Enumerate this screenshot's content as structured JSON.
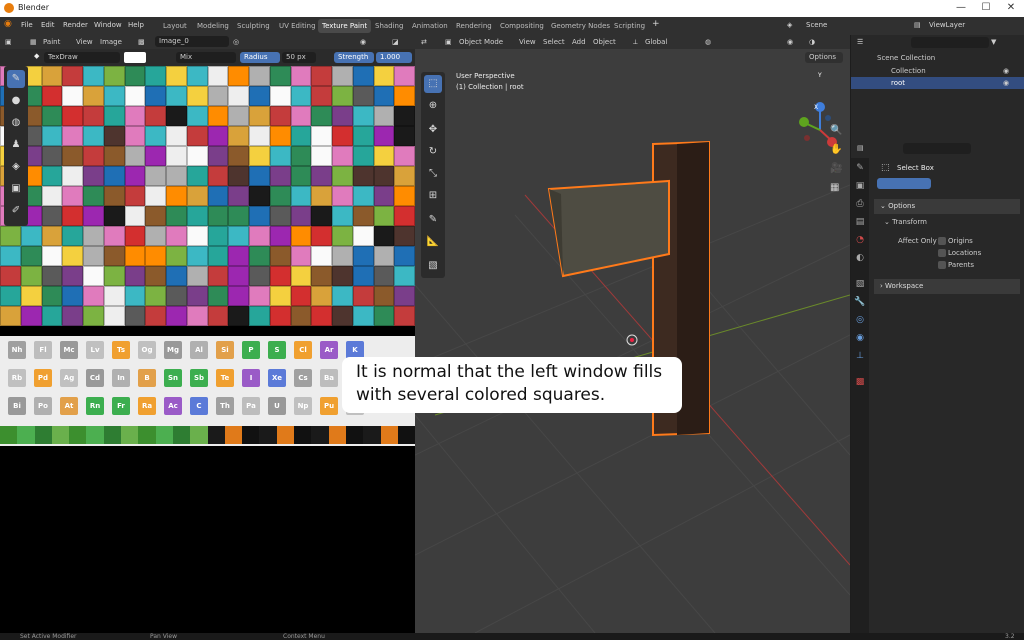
{
  "window": {
    "title": "Blender",
    "controls": [
      "—",
      "☐",
      "✕"
    ]
  },
  "menu": [
    "File",
    "Edit",
    "Render",
    "Window",
    "Help"
  ],
  "workspaces": [
    {
      "label": "Layout",
      "active": false
    },
    {
      "label": "Modeling",
      "active": false
    },
    {
      "label": "Sculpting",
      "active": false
    },
    {
      "label": "UV Editing",
      "active": false
    },
    {
      "label": "Texture Paint",
      "active": true
    },
    {
      "label": "Shading",
      "active": false
    },
    {
      "label": "Animation",
      "active": false
    },
    {
      "label": "Rendering",
      "active": false
    },
    {
      "label": "Compositing",
      "active": false
    },
    {
      "label": "Geometry Nodes",
      "active": false
    },
    {
      "label": "Scripting",
      "active": false
    }
  ],
  "scene": {
    "label": "Scene",
    "view_layer": "ViewLayer"
  },
  "image_editor": {
    "mode": "Paint",
    "menus": [
      "View",
      "Image"
    ],
    "image_name": "Image_0",
    "tool_name": "TexDraw",
    "blend": "Mix",
    "radius_label": "Radius",
    "radius_value": "50 px",
    "strength_label": "Strength",
    "strength_value": "1.000"
  },
  "elements_rows": [
    [
      "Nh",
      "Fl",
      "Mc",
      "Lv",
      "Ts",
      "Og",
      "Mg",
      "Al",
      "Si",
      "P",
      "S",
      "Cl",
      "Ar",
      "K"
    ],
    [
      "Rb",
      "Pd",
      "Ag",
      "Cd",
      "In",
      "B",
      "Sn",
      "Sb",
      "Te",
      "I",
      "Xe",
      "Cs",
      "Ba",
      "La"
    ],
    [
      "Bi",
      "Po",
      "At",
      "Rn",
      "Fr",
      "Ra",
      "Ac",
      "C",
      "Th",
      "Pa",
      "U",
      "Np",
      "Pu",
      "Am"
    ]
  ],
  "viewport": {
    "mode": "Object Mode",
    "menus": [
      "View",
      "Select",
      "Add",
      "Object"
    ],
    "orientation": "Global",
    "options": "Options",
    "perspective": "User Perspective",
    "collection_info": "(1) Collection | root",
    "gizmo_axes": {
      "x": "X",
      "y": "Y",
      "z": "Z"
    }
  },
  "outliner": {
    "scene_collection": "Scene Collection",
    "items": [
      {
        "label": "Collection",
        "selected": false
      },
      {
        "label": "root",
        "selected": true
      }
    ]
  },
  "properties": {
    "tool": "Select Box",
    "options_panel": "Options",
    "transform_panel": "Transform",
    "affect_only_label": "Affect Only",
    "checkboxes": [
      {
        "label": "Origins",
        "checked": false
      },
      {
        "label": "Locations",
        "checked": false
      },
      {
        "label": "Parents",
        "checked": false
      }
    ],
    "workspace_panel": "Workspace"
  },
  "status": {
    "left": "Set Active Modifier",
    "mid": "Pan View",
    "right": "Context Menu",
    "version": "3.2"
  },
  "caption": "It is normal that the left window fills with several colored squares."
}
